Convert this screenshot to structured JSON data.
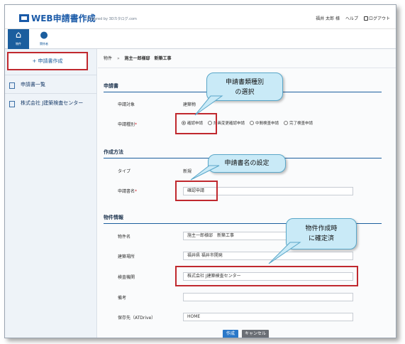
{
  "header": {
    "app_title": "WEB申請書作成",
    "powered_by": "Powered by 3Dカタログ.com",
    "user_name": "福井 太郎 様",
    "help_label": "ヘルプ",
    "logout_label": "ログアウト"
  },
  "nav": {
    "tabs": [
      {
        "label": "物件"
      },
      {
        "label": "関係者"
      }
    ]
  },
  "sidebar": {
    "create_label": "+ 申請書作成",
    "items": [
      {
        "label": "申請書一覧"
      },
      {
        "label": "株式会社 J建築検査センター"
      }
    ]
  },
  "breadcrumb": {
    "root": "物件",
    "separator": "»",
    "current": "施主一郎様邸　新築工事"
  },
  "sections": {
    "application": {
      "title": "申請書",
      "target_label": "申請対象",
      "target_value": "建築物",
      "type_label": "申請種別",
      "required_mark": "*",
      "options": [
        "確認申請",
        "計画変更確認申請",
        "中間検査申請",
        "完了検査申請"
      ],
      "selected_index": 0
    },
    "method": {
      "title": "作成方法",
      "type_label": "タイプ",
      "type_value": "新規",
      "name_label": "申請書名",
      "required_mark": "*",
      "name_value": "確認申請"
    },
    "property": {
      "title": "物件情報",
      "name_label": "物件名",
      "name_value": "施主一郎様邸　新築工事",
      "location_label": "建築場所",
      "location_value": "福井県 福井市開発",
      "agency_label": "検査機関",
      "agency_value": "株式会社 J建築検査センター",
      "note_label": "備考",
      "note_value": "",
      "save_label": "保存先（ATDrive）",
      "save_value": "HOME"
    }
  },
  "buttons": {
    "create": "作成",
    "cancel": "キャンセル"
  },
  "callouts": {
    "type_select": "申請書類種別\nの選択",
    "name_setting": "申請書名の設定",
    "fixed": "物件作成時\nに確定済"
  },
  "colors": {
    "accent": "#1b5e9e",
    "highlight": "#c0282e",
    "callout_fill": "#c9eaf7"
  }
}
